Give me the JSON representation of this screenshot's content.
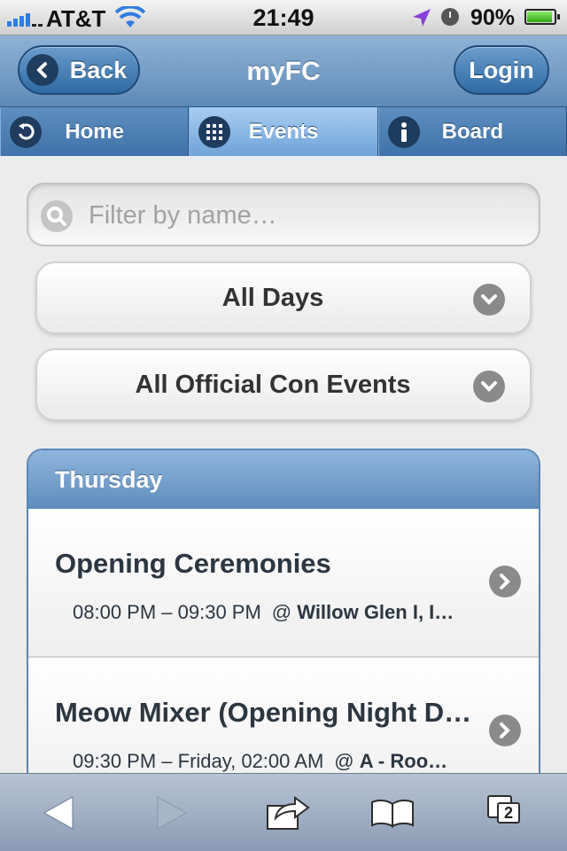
{
  "status_bar": {
    "carrier": "AT&T",
    "time": "21:49",
    "battery_percent": "90%",
    "icons": [
      "signal-bars-icon",
      "wifi-icon",
      "location-arrow-icon",
      "alarm-clock-icon",
      "battery-icon"
    ]
  },
  "header": {
    "back_label": "Back",
    "title": "myFC",
    "login_label": "Login"
  },
  "navbar": {
    "items": [
      {
        "label": "Home",
        "icon": "back-arrow-icon",
        "active": false
      },
      {
        "label": "Events",
        "icon": "grid-icon",
        "active": true
      },
      {
        "label": "Board",
        "icon": "info-icon",
        "active": false
      }
    ]
  },
  "filter": {
    "placeholder": "Filter by name…",
    "value": ""
  },
  "selects": {
    "day": "All Days",
    "category": "All Official Con Events"
  },
  "schedule": {
    "day_header": "Thursday",
    "events": [
      {
        "title": "Opening Ceremonies",
        "time": "08:00 PM – 09:30 PM",
        "location": "Willow Glen I, I…"
      },
      {
        "title": "Meow Mixer (Opening Night D…",
        "time": "09:30 PM – Friday, 02:00 AM",
        "location": "A - Roo…"
      }
    ]
  },
  "toolbar": {
    "tab_count": "2",
    "icons": [
      "back-icon",
      "forward-icon",
      "share-icon",
      "bookmarks-icon",
      "tabs-icon"
    ]
  },
  "colors": {
    "header_blue": "#6f97c3",
    "nav_active": "#8dbbe6",
    "page_bg": "#ececec"
  }
}
